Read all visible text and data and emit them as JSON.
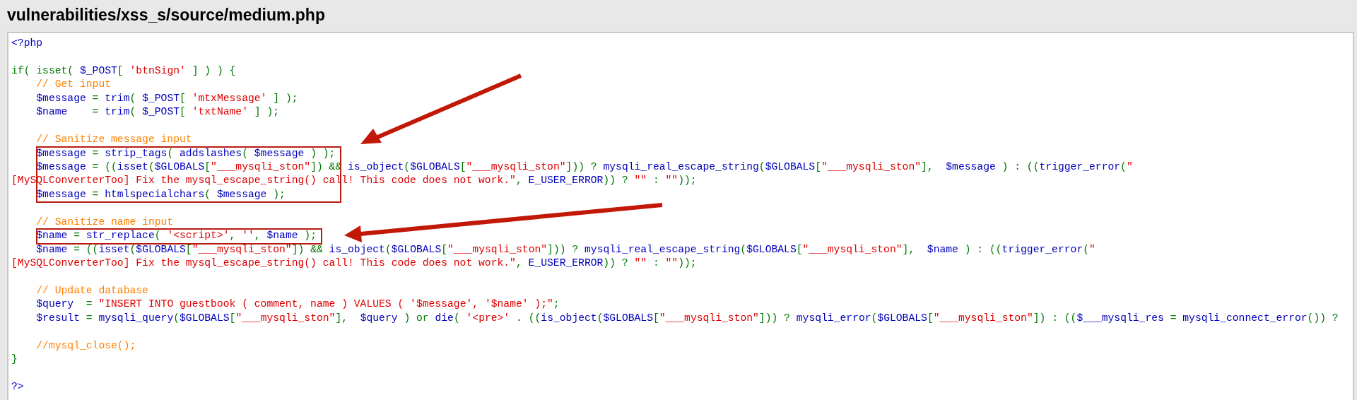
{
  "title": "vulnerabilities/xss_s/source/medium.php",
  "code": {
    "blocks": [
      {
        "boxed": false,
        "lines": [
          {
            "kind": "code",
            "tokens": [
              {
                "t": "<?php",
                "kind": "default"
              }
            ]
          },
          {
            "kind": "blank"
          },
          {
            "kind": "code",
            "tokens": [
              {
                "t": "if( isset( ",
                "kind": "keyword"
              },
              {
                "t": "$_POST",
                "kind": "default"
              },
              {
                "t": "[ ",
                "kind": "keyword"
              },
              {
                "t": "'btnSign'",
                "kind": "string"
              },
              {
                "t": " ] ) ) {",
                "kind": "keyword"
              }
            ]
          },
          {
            "kind": "code",
            "tokens": [
              {
                "t": "    // Get input",
                "kind": "comment"
              }
            ]
          },
          {
            "kind": "code",
            "tokens": [
              {
                "t": "    $message ",
                "kind": "default"
              },
              {
                "t": "= ",
                "kind": "keyword"
              },
              {
                "t": "trim",
                "kind": "default"
              },
              {
                "t": "( ",
                "kind": "keyword"
              },
              {
                "t": "$_POST",
                "kind": "default"
              },
              {
                "t": "[ ",
                "kind": "keyword"
              },
              {
                "t": "'mtxMessage'",
                "kind": "string"
              },
              {
                "t": " ] );",
                "kind": "keyword"
              }
            ]
          },
          {
            "kind": "code",
            "tokens": [
              {
                "t": "    $name    ",
                "kind": "default"
              },
              {
                "t": "= ",
                "kind": "keyword"
              },
              {
                "t": "trim",
                "kind": "default"
              },
              {
                "t": "( ",
                "kind": "keyword"
              },
              {
                "t": "$_POST",
                "kind": "default"
              },
              {
                "t": "[ ",
                "kind": "keyword"
              },
              {
                "t": "'txtName'",
                "kind": "string"
              },
              {
                "t": " ] );",
                "kind": "keyword"
              }
            ]
          },
          {
            "kind": "blank"
          },
          {
            "kind": "code",
            "tokens": [
              {
                "t": "    // Sanitize message input",
                "kind": "comment"
              }
            ]
          }
        ]
      },
      {
        "boxed": true,
        "lines": [
          {
            "kind": "code",
            "tokens": [
              {
                "t": "    $message ",
                "kind": "default"
              },
              {
                "t": "= ",
                "kind": "keyword"
              },
              {
                "t": "strip_tags",
                "kind": "default"
              },
              {
                "t": "( ",
                "kind": "keyword"
              },
              {
                "t": "addslashes",
                "kind": "default"
              },
              {
                "t": "( ",
                "kind": "keyword"
              },
              {
                "t": "$message ",
                "kind": "default"
              },
              {
                "t": ") );",
                "kind": "keyword"
              }
            ]
          },
          {
            "kind": "code",
            "tokens": [
              {
                "t": "    $message ",
                "kind": "default"
              },
              {
                "t": "= ((",
                "kind": "keyword"
              },
              {
                "t": "isset",
                "kind": "default"
              },
              {
                "t": "(",
                "kind": "keyword"
              },
              {
                "t": "$GLOBALS",
                "kind": "default"
              },
              {
                "t": "[",
                "kind": "keyword"
              },
              {
                "t": "\"___mysqli_ston\"",
                "kind": "string"
              },
              {
                "t": "]) && ",
                "kind": "keyword"
              },
              {
                "t": "is_object",
                "kind": "default"
              },
              {
                "t": "(",
                "kind": "keyword"
              },
              {
                "t": "$GLOBALS",
                "kind": "default"
              },
              {
                "t": "[",
                "kind": "keyword"
              },
              {
                "t": "\"___mysqli_ston\"",
                "kind": "string"
              },
              {
                "t": "])) ? ",
                "kind": "keyword"
              },
              {
                "t": "mysqli_real_escape_string",
                "kind": "default"
              },
              {
                "t": "(",
                "kind": "keyword"
              },
              {
                "t": "$GLOBALS",
                "kind": "default"
              },
              {
                "t": "[",
                "kind": "keyword"
              },
              {
                "t": "\"___mysqli_ston\"",
                "kind": "string"
              },
              {
                "t": "],  ",
                "kind": "keyword"
              },
              {
                "t": "$message ",
                "kind": "default"
              },
              {
                "t": ") : ((",
                "kind": "keyword"
              },
              {
                "t": "trigger_error",
                "kind": "default"
              },
              {
                "t": "(",
                "kind": "keyword"
              },
              {
                "t": "\"",
                "kind": "string"
              }
            ]
          },
          {
            "kind": "code",
            "tokens": [
              {
                "t": "[MySQLConverterToo] Fix the mysql_escape_string() call! This code does not work.\"",
                "kind": "string"
              },
              {
                "t": ", ",
                "kind": "keyword"
              },
              {
                "t": "E_USER_ERROR",
                "kind": "default"
              },
              {
                "t": ")) ? ",
                "kind": "keyword"
              },
              {
                "t": "\"\"",
                "kind": "string"
              },
              {
                "t": " : ",
                "kind": "keyword"
              },
              {
                "t": "\"\"",
                "kind": "string"
              },
              {
                "t": "));",
                "kind": "keyword"
              }
            ]
          },
          {
            "kind": "code",
            "tokens": [
              {
                "t": "    $message ",
                "kind": "default"
              },
              {
                "t": "= ",
                "kind": "keyword"
              },
              {
                "t": "htmlspecialchars",
                "kind": "default"
              },
              {
                "t": "( ",
                "kind": "keyword"
              },
              {
                "t": "$message ",
                "kind": "default"
              },
              {
                "t": ");",
                "kind": "keyword"
              }
            ]
          }
        ]
      },
      {
        "boxed": false,
        "lines": [
          {
            "kind": "blank"
          },
          {
            "kind": "code",
            "tokens": [
              {
                "t": "    // Sanitize name input",
                "kind": "comment"
              }
            ]
          }
        ]
      },
      {
        "boxed": true,
        "lines": [
          {
            "kind": "code",
            "tokens": [
              {
                "t": "    $name ",
                "kind": "default"
              },
              {
                "t": "= ",
                "kind": "keyword"
              },
              {
                "t": "str_replace",
                "kind": "default"
              },
              {
                "t": "( ",
                "kind": "keyword"
              },
              {
                "t": "'<script>'",
                "kind": "string"
              },
              {
                "t": ", ",
                "kind": "keyword"
              },
              {
                "t": "''",
                "kind": "string"
              },
              {
                "t": ", ",
                "kind": "keyword"
              },
              {
                "t": "$name ",
                "kind": "default"
              },
              {
                "t": ");",
                "kind": "keyword"
              }
            ]
          }
        ]
      },
      {
        "boxed": false,
        "lines": [
          {
            "kind": "code",
            "tokens": [
              {
                "t": "    $name ",
                "kind": "default"
              },
              {
                "t": "= ((",
                "kind": "keyword"
              },
              {
                "t": "isset",
                "kind": "default"
              },
              {
                "t": "(",
                "kind": "keyword"
              },
              {
                "t": "$GLOBALS",
                "kind": "default"
              },
              {
                "t": "[",
                "kind": "keyword"
              },
              {
                "t": "\"___mysqli_ston\"",
                "kind": "string"
              },
              {
                "t": "]) && ",
                "kind": "keyword"
              },
              {
                "t": "is_object",
                "kind": "default"
              },
              {
                "t": "(",
                "kind": "keyword"
              },
              {
                "t": "$GLOBALS",
                "kind": "default"
              },
              {
                "t": "[",
                "kind": "keyword"
              },
              {
                "t": "\"___mysqli_ston\"",
                "kind": "string"
              },
              {
                "t": "])) ? ",
                "kind": "keyword"
              },
              {
                "t": "mysqli_real_escape_string",
                "kind": "default"
              },
              {
                "t": "(",
                "kind": "keyword"
              },
              {
                "t": "$GLOBALS",
                "kind": "default"
              },
              {
                "t": "[",
                "kind": "keyword"
              },
              {
                "t": "\"___mysqli_ston\"",
                "kind": "string"
              },
              {
                "t": "],  ",
                "kind": "keyword"
              },
              {
                "t": "$name ",
                "kind": "default"
              },
              {
                "t": ") : ((",
                "kind": "keyword"
              },
              {
                "t": "trigger_error",
                "kind": "default"
              },
              {
                "t": "(",
                "kind": "keyword"
              },
              {
                "t": "\"",
                "kind": "string"
              }
            ]
          },
          {
            "kind": "code",
            "tokens": [
              {
                "t": "[MySQLConverterToo] Fix the mysql_escape_string() call! This code does not work.\"",
                "kind": "string"
              },
              {
                "t": ", ",
                "kind": "keyword"
              },
              {
                "t": "E_USER_ERROR",
                "kind": "default"
              },
              {
                "t": ")) ? ",
                "kind": "keyword"
              },
              {
                "t": "\"\"",
                "kind": "string"
              },
              {
                "t": " : ",
                "kind": "keyword"
              },
              {
                "t": "\"\"",
                "kind": "string"
              },
              {
                "t": "));",
                "kind": "keyword"
              }
            ]
          },
          {
            "kind": "blank"
          },
          {
            "kind": "code",
            "tokens": [
              {
                "t": "    // Update database",
                "kind": "comment"
              }
            ]
          },
          {
            "kind": "code",
            "tokens": [
              {
                "t": "    $query  ",
                "kind": "default"
              },
              {
                "t": "= ",
                "kind": "keyword"
              },
              {
                "t": "\"INSERT INTO guestbook ( comment, name ) VALUES ( '$message', '$name' );\"",
                "kind": "string"
              },
              {
                "t": ";",
                "kind": "keyword"
              }
            ]
          },
          {
            "kind": "code",
            "tokens": [
              {
                "t": "    $result ",
                "kind": "default"
              },
              {
                "t": "= ",
                "kind": "keyword"
              },
              {
                "t": "mysqli_query",
                "kind": "default"
              },
              {
                "t": "(",
                "kind": "keyword"
              },
              {
                "t": "$GLOBALS",
                "kind": "default"
              },
              {
                "t": "[",
                "kind": "keyword"
              },
              {
                "t": "\"___mysqli_ston\"",
                "kind": "string"
              },
              {
                "t": "],  ",
                "kind": "keyword"
              },
              {
                "t": "$query ",
                "kind": "default"
              },
              {
                "t": ") or ",
                "kind": "keyword"
              },
              {
                "t": "die",
                "kind": "default"
              },
              {
                "t": "( ",
                "kind": "keyword"
              },
              {
                "t": "'<pre>'",
                "kind": "string"
              },
              {
                "t": " . ((",
                "kind": "keyword"
              },
              {
                "t": "is_object",
                "kind": "default"
              },
              {
                "t": "(",
                "kind": "keyword"
              },
              {
                "t": "$GLOBALS",
                "kind": "default"
              },
              {
                "t": "[",
                "kind": "keyword"
              },
              {
                "t": "\"___mysqli_ston\"",
                "kind": "string"
              },
              {
                "t": "])) ? ",
                "kind": "keyword"
              },
              {
                "t": "mysqli_error",
                "kind": "default"
              },
              {
                "t": "(",
                "kind": "keyword"
              },
              {
                "t": "$GLOBALS",
                "kind": "default"
              },
              {
                "t": "[",
                "kind": "keyword"
              },
              {
                "t": "\"___mysqli_ston\"",
                "kind": "string"
              },
              {
                "t": "]) : ((",
                "kind": "keyword"
              },
              {
                "t": "$___mysqli_res ",
                "kind": "default"
              },
              {
                "t": "= ",
                "kind": "keyword"
              },
              {
                "t": "mysqli_connect_error",
                "kind": "default"
              },
              {
                "t": "()) ?",
                "kind": "keyword"
              }
            ]
          },
          {
            "kind": "blank"
          },
          {
            "kind": "code",
            "tokens": [
              {
                "t": "    //mysql_close();",
                "kind": "comment"
              }
            ]
          },
          {
            "kind": "code",
            "tokens": [
              {
                "t": "}",
                "kind": "keyword"
              }
            ]
          },
          {
            "kind": "blank"
          },
          {
            "kind": "code",
            "tokens": [
              {
                "t": "?>",
                "kind": "default"
              }
            ]
          }
        ]
      }
    ]
  }
}
